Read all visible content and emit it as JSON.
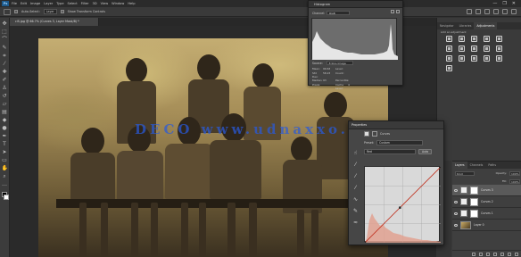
{
  "app": {
    "logo": "Ps"
  },
  "menu": [
    "File",
    "Edit",
    "Image",
    "Layer",
    "Type",
    "Select",
    "Filter",
    "3D",
    "View",
    "Window",
    "Help"
  ],
  "window_controls": [
    "—",
    "❐",
    "✕"
  ],
  "options_bar": {
    "auto_select_label": "Auto-Select:",
    "auto_select_value": "Layer",
    "show_transform_label": "Show Transform Controls"
  },
  "document": {
    "tab_title": "clS.jpg @ 66.7% (Curves 3, Layer Mask/8) *"
  },
  "watermark": {
    "text": "DECO  www.udnaxxo.ch"
  },
  "histogram": {
    "title": "Histogram",
    "channel_label": "Channel:",
    "channel_value": "RGB",
    "source_label": "Source:",
    "source_value": "Entire Image",
    "stats": {
      "mean_label": "Mean:",
      "mean_value": "99.63",
      "std_label": "Std Dev:",
      "std_value": "58.23",
      "median_label": "Median:",
      "median_value": "93",
      "pixels_label": "Pixels:",
      "pixels_value": "",
      "level_label": "Level:",
      "level_value": "",
      "count_label": "Count:",
      "count_value": "",
      "percentile_label": "Percentile:",
      "percentile_value": "",
      "cache_label": "Cache Level:",
      "cache_value": "4"
    },
    "colors": {
      "fill": "#e6e6e6",
      "bg": "#6d6d6d"
    }
  },
  "adjustments": {
    "tabs": [
      "Navigator",
      "Libraries",
      "Adjustments"
    ],
    "active_tab": "Adjustments",
    "hint": "Add an adjustment",
    "icons": [
      "brightness-icon",
      "levels-icon",
      "curves-icon",
      "exposure-icon",
      "vibrance-icon",
      "hue-saturation-icon",
      "color-balance-icon",
      "black-white-icon",
      "photo-filter-icon",
      "channel-mixer-icon",
      "color-lookup-icon",
      "invert-icon",
      "posterize-icon",
      "threshold-icon",
      "gradient-map-icon",
      "selective-color-icon"
    ]
  },
  "layers": {
    "tabs": [
      "Layers",
      "Channels",
      "Paths"
    ],
    "active_tab": "Layers",
    "kind_label": "Kind",
    "opacity_label": "Opacity:",
    "opacity_value": "100%",
    "fill_label": "Fill:",
    "fill_value": "100%",
    "items": [
      {
        "name": "Curves 3",
        "type": "adjustment",
        "active": true
      },
      {
        "name": "Curves 2",
        "type": "adjustment",
        "active": false
      },
      {
        "name": "Curves 1",
        "type": "adjustment",
        "active": false
      },
      {
        "name": "Layer 0",
        "type": "image",
        "active": false
      }
    ]
  },
  "properties": {
    "title": "Properties",
    "panel_name": "Curves",
    "preset_label": "Preset:",
    "preset_value": "Custom",
    "channel_value": "Red",
    "auto_label": "Auto",
    "curve": {
      "color": "#c0301e",
      "points": [
        [
          0,
          0
        ],
        [
          118,
          118
        ],
        [
          255,
          255
        ]
      ]
    }
  }
}
